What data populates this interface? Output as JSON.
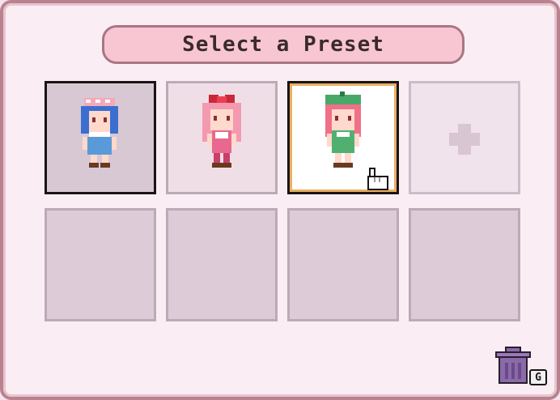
{
  "dialog": {
    "title": "Select a Preset"
  },
  "slots": [
    {
      "state": "filled",
      "character": "blue-hair-kerchief-overalls"
    },
    {
      "state": "filled",
      "character": "pink-hair-red-bow"
    },
    {
      "state": "filled-selected",
      "character": "green-beret-pink-hair"
    },
    {
      "state": "add"
    },
    {
      "state": "empty"
    },
    {
      "state": "empty"
    },
    {
      "state": "empty"
    },
    {
      "state": "empty"
    }
  ],
  "trash": {
    "key_hint": "G"
  },
  "colors": {
    "accent": "#f8c6d3",
    "panel": "#faeef4",
    "border": "#b8838f",
    "selected_border": "#e8b060"
  }
}
